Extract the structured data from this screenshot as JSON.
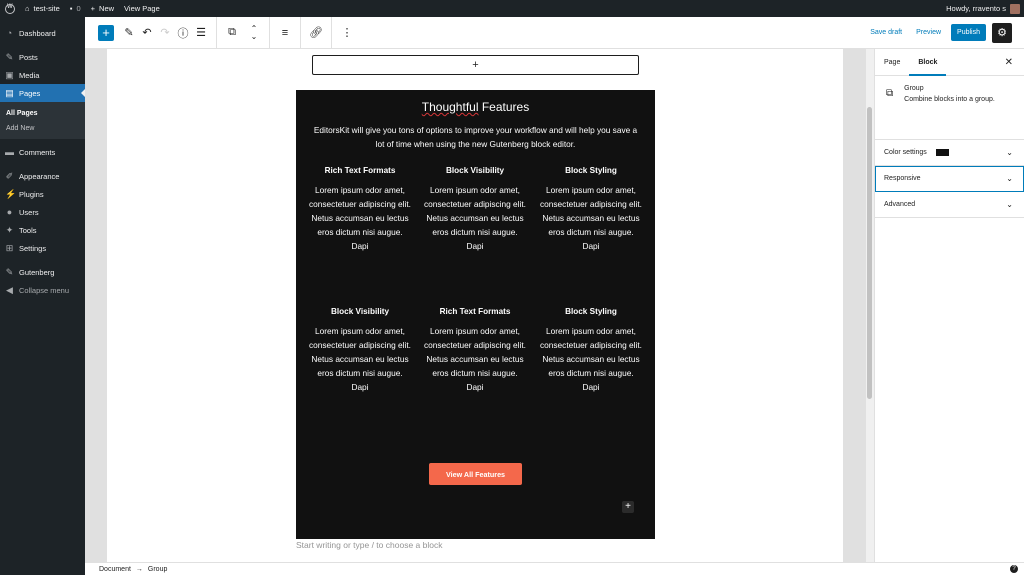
{
  "adminbar": {
    "site": "test-site",
    "comments_count": "0",
    "new": "New",
    "view_page": "View Page",
    "howdy": "Howdy, rravento s"
  },
  "sidebar": {
    "items": [
      {
        "label": "Dashboard",
        "icon": "dashboard-icon"
      },
      {
        "label": "Posts",
        "icon": "pin-icon"
      },
      {
        "label": "Media",
        "icon": "media-icon"
      },
      {
        "label": "Pages",
        "icon": "pages-icon"
      },
      {
        "label": "Comments",
        "icon": "comments-icon"
      },
      {
        "label": "Appearance",
        "icon": "brush-icon"
      },
      {
        "label": "Plugins",
        "icon": "plug-icon"
      },
      {
        "label": "Users",
        "icon": "users-icon"
      },
      {
        "label": "Tools",
        "icon": "wrench-icon"
      },
      {
        "label": "Settings",
        "icon": "settings-icon"
      },
      {
        "label": "Gutenberg",
        "icon": "gutenberg-icon"
      },
      {
        "label": "Collapse menu",
        "icon": "collapse-icon"
      }
    ],
    "submenu": [
      "All Pages",
      "Add New"
    ]
  },
  "toolbar": {
    "save_draft": "Save draft",
    "preview": "Preview",
    "publish": "Publish"
  },
  "content": {
    "title_part1": "Thoughtful",
    "title_part2": " Features",
    "intro": "EditorsKit will give you tons of options to improve your workflow and will help you save a lot of time when using the new Gutenberg block editor.",
    "features": [
      {
        "heading": "Rich Text Formats",
        "body": "Lorem ipsum odor amet, consectetuer adipiscing elit. Netus accumsan eu lectus eros dictum nisi augue. Dapi"
      },
      {
        "heading": "Block Visibility",
        "body": "Lorem ipsum odor amet, consectetuer adipiscing elit. Netus accumsan eu lectus eros dictum nisi augue. Dapi"
      },
      {
        "heading": "Block Styling",
        "body": "Lorem ipsum odor amet, consectetuer adipiscing elit. Netus accumsan eu lectus eros dictum nisi augue. Dapi"
      },
      {
        "heading": "Block Visibility",
        "body": "Lorem ipsum odor amet, consectetuer adipiscing elit. Netus accumsan eu lectus eros dictum nisi augue. Dapi"
      },
      {
        "heading": "Rich Text Formats",
        "body": "Lorem ipsum odor amet, consectetuer adipiscing elit. Netus accumsan eu lectus eros dictum nisi augue. Dapi"
      },
      {
        "heading": "Block Styling",
        "body": "Lorem ipsum odor amet, consectetuer adipiscing elit. Netus accumsan eu lectus eros dictum nisi augue. Dapi"
      }
    ],
    "cta": "View All Features",
    "placeholder": "Start writing or type / to choose a block"
  },
  "panel": {
    "tab_page": "Page",
    "tab_block": "Block",
    "block_name": "Group",
    "block_desc": "Combine blocks into a group.",
    "sections": [
      "Color settings",
      "Responsive",
      "Advanced"
    ],
    "swatch_color": "#111111"
  },
  "footer": {
    "crumb1": "Document",
    "arrow": "→",
    "crumb2": "Group",
    "help": "?"
  },
  "colors": {
    "accent": "#007cba",
    "admin_dark": "#1d2327",
    "cta": "#f4684b"
  }
}
